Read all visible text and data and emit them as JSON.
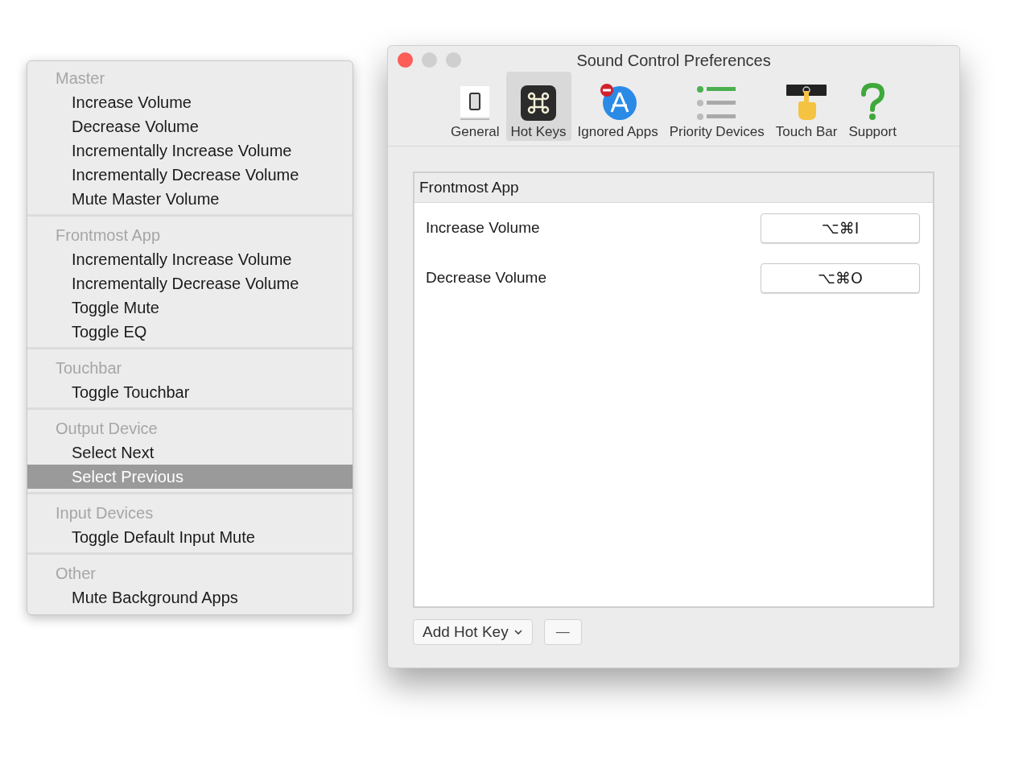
{
  "menu": {
    "sections": [
      {
        "header": "Master",
        "items": [
          {
            "label": "Increase Volume",
            "selected": false
          },
          {
            "label": "Decrease Volume",
            "selected": false
          },
          {
            "label": "Incrementally Increase Volume",
            "selected": false
          },
          {
            "label": "Incrementally Decrease Volume",
            "selected": false
          },
          {
            "label": "Mute Master Volume",
            "selected": false
          }
        ]
      },
      {
        "header": "Frontmost App",
        "items": [
          {
            "label": "Incrementally Increase Volume",
            "selected": false
          },
          {
            "label": "Incrementally Decrease Volume",
            "selected": false
          },
          {
            "label": "Toggle Mute",
            "selected": false
          },
          {
            "label": "Toggle EQ",
            "selected": false
          }
        ]
      },
      {
        "header": "Touchbar",
        "items": [
          {
            "label": "Toggle Touchbar",
            "selected": false
          }
        ]
      },
      {
        "header": "Output Device",
        "items": [
          {
            "label": "Select Next",
            "selected": false
          },
          {
            "label": "Select Previous",
            "selected": true
          }
        ]
      },
      {
        "header": "Input Devices",
        "items": [
          {
            "label": "Toggle Default Input Mute",
            "selected": false
          }
        ]
      },
      {
        "header": "Other",
        "items": [
          {
            "label": "Mute Background Apps",
            "selected": false
          }
        ]
      }
    ]
  },
  "window": {
    "title": "Sound Control Preferences",
    "tabs": [
      {
        "label": "General",
        "kind": "switch",
        "selected": false
      },
      {
        "label": "Hot Keys",
        "kind": "command",
        "selected": true
      },
      {
        "label": "Ignored Apps",
        "kind": "appstore",
        "selected": false
      },
      {
        "label": "Priority Devices",
        "kind": "list",
        "selected": false
      },
      {
        "label": "Touch Bar",
        "kind": "touchbar",
        "selected": false
      },
      {
        "label": "Support",
        "kind": "question",
        "selected": false
      }
    ],
    "table": {
      "header": "Frontmost App",
      "rows": [
        {
          "action": "Increase Volume",
          "shortcut": "⌥⌘I"
        },
        {
          "action": "Decrease Volume",
          "shortcut": "⌥⌘O"
        }
      ]
    },
    "add_button": "Add Hot Key",
    "remove_button": "—"
  }
}
